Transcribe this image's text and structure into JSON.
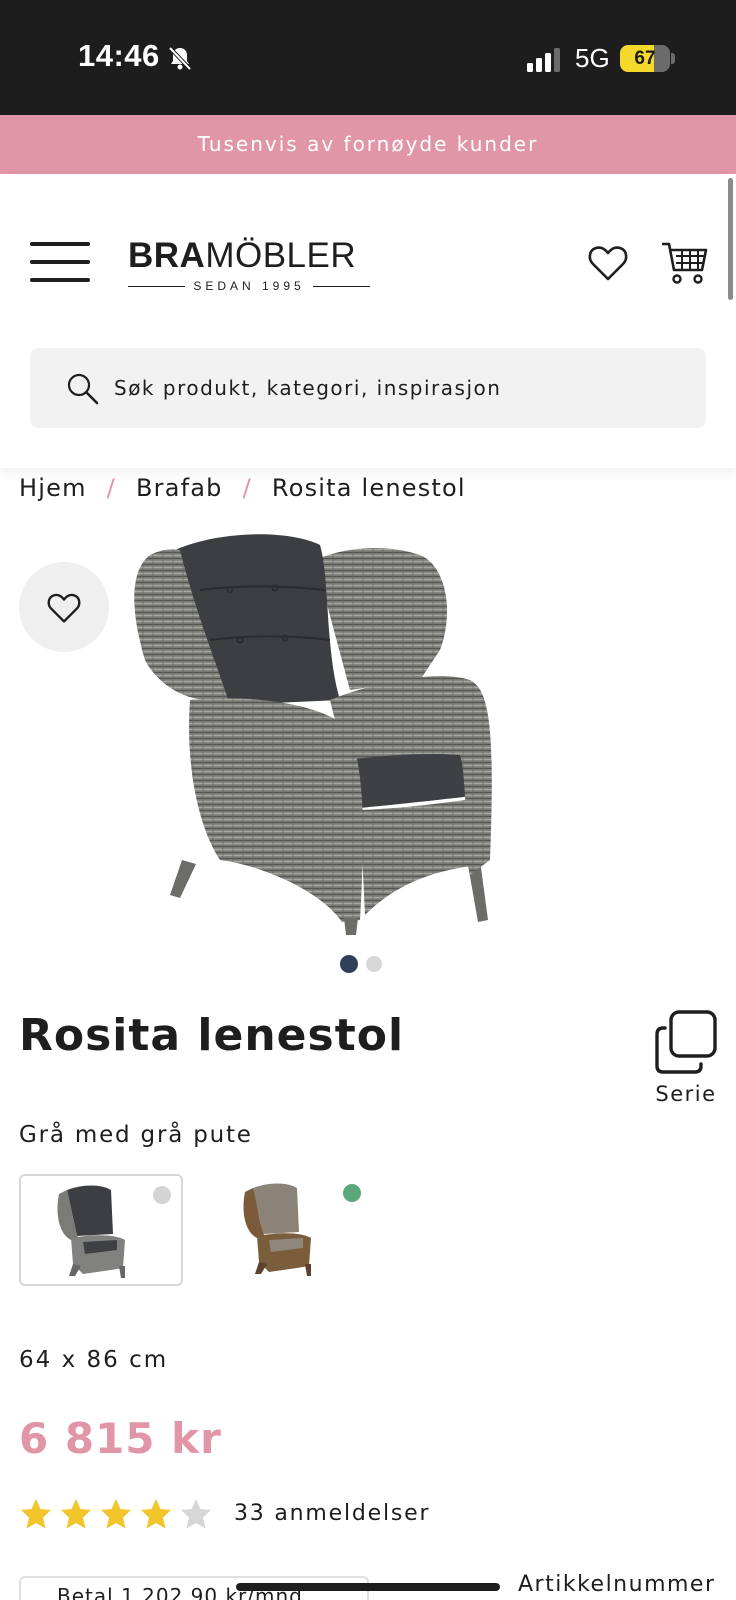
{
  "status_bar": {
    "time": "14:46",
    "network": "5G",
    "battery": "67",
    "battery_level": 0.67,
    "icons": [
      "bell-muted-icon",
      "signal-icon",
      "battery-icon"
    ]
  },
  "promo_banner": {
    "text": "Tusenvis av fornøyde kunder"
  },
  "header": {
    "logo": {
      "bold": "BRA",
      "light": "MÖBLER",
      "sub": "SEDAN 1995"
    },
    "search": {
      "placeholder": "Søk produkt, kategori, inspirasjon"
    },
    "icons": [
      "menu-icon",
      "heart-icon",
      "cart-icon",
      "search-icon"
    ]
  },
  "breadcrumb": {
    "items": [
      "Hjem",
      "Brafab",
      "Rosita lenestol"
    ],
    "separator": "/"
  },
  "carousel": {
    "count": 2,
    "active_index": 0
  },
  "product": {
    "title": "Rosita lenestol",
    "series_label": "Serie",
    "variant_label": "Grå med grå pute",
    "variants": [
      {
        "color": "grey",
        "dot_color": "#d4d4d4",
        "selected": true
      },
      {
        "color": "brown",
        "dot_color": "#5aa77a",
        "selected": false
      }
    ],
    "dimensions": "64 x 86 cm",
    "price": "6 815 kr",
    "rating": 4,
    "rating_max": 5,
    "reviews": "33 anmeldelser",
    "installment": "Betal 1 202,90 kr/mnd",
    "article_label": "Artikkelnummer"
  },
  "colors": {
    "accent_pink": "#e196a8",
    "star_yellow": "#f2c52a",
    "star_empty": "#d7d7d7"
  }
}
